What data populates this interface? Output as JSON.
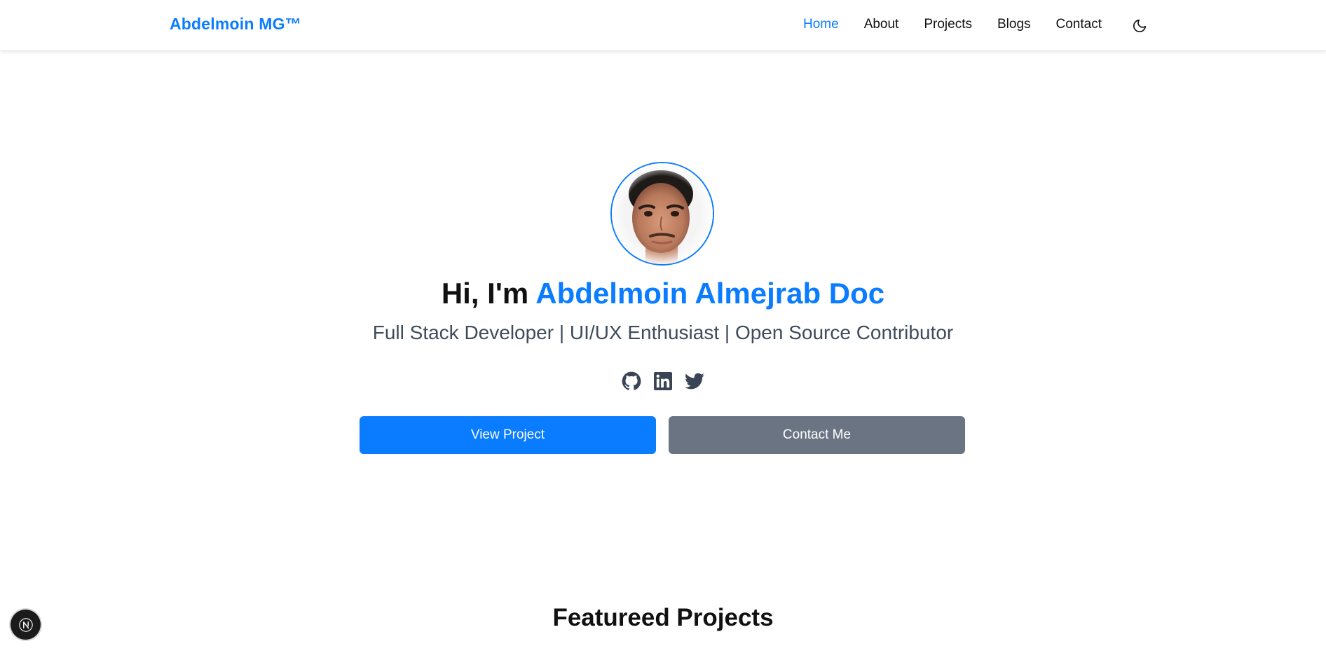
{
  "nav": {
    "brand": "Abdelmoin MG™",
    "links": [
      {
        "label": "Home",
        "active": true
      },
      {
        "label": "About",
        "active": false
      },
      {
        "label": "Projects",
        "active": false
      },
      {
        "label": "Blogs",
        "active": false
      },
      {
        "label": "Contact",
        "active": false
      }
    ],
    "theme_toggle_icon": "moon-icon"
  },
  "hero": {
    "greeting": "Hi, I'm ",
    "name": "Abdelmoin Almejrab Doc",
    "subtitle": "Full Stack Developer | UI/UX Enthusiast | Open Source Contributor",
    "socials": [
      {
        "icon": "github-icon"
      },
      {
        "icon": "linkedin-icon"
      },
      {
        "icon": "twitter-icon"
      }
    ],
    "primary_button": "View Project",
    "secondary_button": "Contact Me"
  },
  "featured": {
    "title": "Featureed Projects"
  },
  "colors": {
    "accent": "#0a7cff",
    "secondary_button": "#6b7483",
    "subtitle_text": "#3f4b5b"
  }
}
